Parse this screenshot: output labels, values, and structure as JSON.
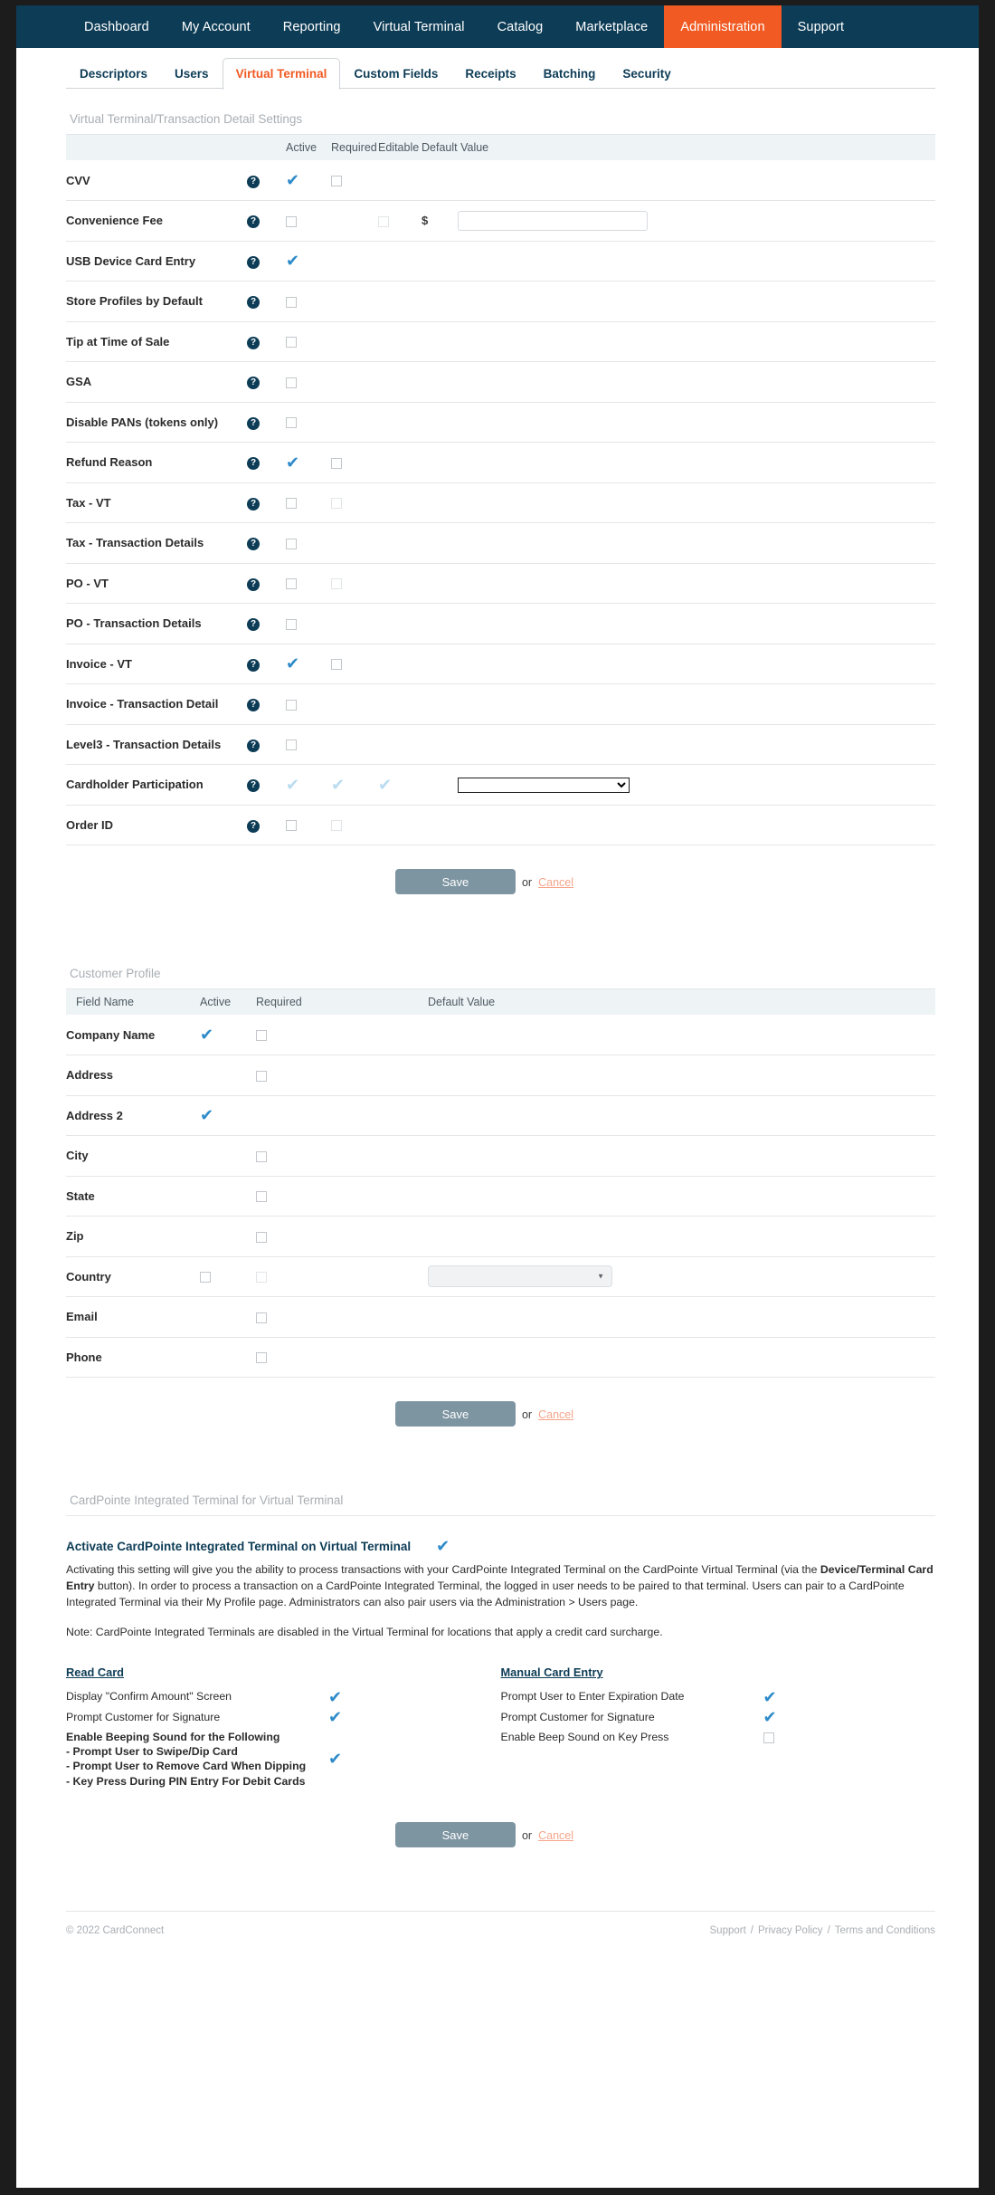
{
  "topnav": {
    "items": [
      {
        "label": "Dashboard",
        "active": false
      },
      {
        "label": "My Account",
        "active": false
      },
      {
        "label": "Reporting",
        "active": false
      },
      {
        "label": "Virtual Terminal",
        "active": false
      },
      {
        "label": "Catalog",
        "active": false
      },
      {
        "label": "Marketplace",
        "active": false
      },
      {
        "label": "Administration",
        "active": true
      },
      {
        "label": "Support",
        "active": false
      }
    ],
    "active_color": "#f15a22",
    "bar_color": "#0d3c56"
  },
  "subtabs": {
    "items": [
      {
        "label": "Descriptors",
        "active": false
      },
      {
        "label": "Users",
        "active": false
      },
      {
        "label": "Virtual Terminal",
        "active": true
      },
      {
        "label": "Custom Fields",
        "active": false
      },
      {
        "label": "Receipts",
        "active": false
      },
      {
        "label": "Batching",
        "active": false
      },
      {
        "label": "Security",
        "active": false
      }
    ]
  },
  "vt_section": {
    "title": "Virtual Terminal/Transaction Detail Settings",
    "columns": [
      "",
      "Active",
      "Required",
      "Editable",
      "Default Value"
    ],
    "rows": [
      {
        "label": "CVV",
        "help": true,
        "active": "checked",
        "required": "unchecked",
        "editable": "none",
        "default": "none"
      },
      {
        "label": "Convenience Fee",
        "help": true,
        "active": "unchecked",
        "required": "none",
        "editable": "unchecked-faded",
        "default": "money-input",
        "default_value": "",
        "currency": "$"
      },
      {
        "label": "USB Device Card Entry",
        "help": true,
        "active": "checked",
        "required": "none",
        "editable": "none",
        "default": "none"
      },
      {
        "label": "Store Profiles by Default",
        "help": true,
        "active": "unchecked",
        "required": "none",
        "editable": "none",
        "default": "none"
      },
      {
        "label": "Tip at Time of Sale",
        "help": true,
        "active": "unchecked",
        "required": "none",
        "editable": "none",
        "default": "none"
      },
      {
        "label": "GSA",
        "help": true,
        "active": "unchecked",
        "required": "none",
        "editable": "none",
        "default": "none"
      },
      {
        "label": "Disable PANs (tokens only)",
        "help": true,
        "active": "unchecked",
        "required": "none",
        "editable": "none",
        "default": "none"
      },
      {
        "label": "Refund Reason",
        "help": true,
        "active": "checked",
        "required": "unchecked",
        "editable": "none",
        "default": "none"
      },
      {
        "label": "Tax - VT",
        "help": true,
        "active": "unchecked",
        "required": "unchecked-faded",
        "editable": "none",
        "default": "none"
      },
      {
        "label": "Tax - Transaction Details",
        "help": true,
        "active": "unchecked",
        "required": "none",
        "editable": "none",
        "default": "none"
      },
      {
        "label": "PO - VT",
        "help": true,
        "active": "unchecked",
        "required": "unchecked-faded",
        "editable": "none",
        "default": "none"
      },
      {
        "label": "PO - Transaction Details",
        "help": true,
        "active": "unchecked",
        "required": "none",
        "editable": "none",
        "default": "none"
      },
      {
        "label": "Invoice - VT",
        "help": true,
        "active": "checked",
        "required": "unchecked",
        "editable": "none",
        "default": "none"
      },
      {
        "label": "Invoice - Transaction Detail",
        "help": true,
        "active": "unchecked",
        "required": "none",
        "editable": "none",
        "default": "none"
      },
      {
        "label": "Level3 - Transaction Details",
        "help": true,
        "active": "unchecked",
        "required": "none",
        "editable": "none",
        "default": "none"
      },
      {
        "label": "Cardholder Participation",
        "help": true,
        "active": "checked-faded",
        "required": "checked-faded",
        "editable": "checked-faded",
        "default": "select",
        "default_value": ""
      },
      {
        "label": "Order ID",
        "help": true,
        "active": "unchecked",
        "required": "unchecked-faded",
        "editable": "none",
        "default": "none"
      }
    ],
    "save_label": "Save",
    "or_label": "or",
    "cancel_label": "Cancel"
  },
  "customer_profile": {
    "title": "Customer Profile",
    "columns": [
      "Field Name",
      "Active",
      "Required",
      "Default Value"
    ],
    "rows": [
      {
        "label": "Company Name",
        "active": "checked",
        "required": "unchecked",
        "default": "none"
      },
      {
        "label": "Address",
        "active": "none",
        "required": "unchecked",
        "default": "none"
      },
      {
        "label": "Address 2",
        "active": "checked",
        "required": "none",
        "default": "none"
      },
      {
        "label": "City",
        "active": "none",
        "required": "unchecked",
        "default": "none"
      },
      {
        "label": "State",
        "active": "none",
        "required": "unchecked",
        "default": "none"
      },
      {
        "label": "Zip",
        "active": "none",
        "required": "unchecked",
        "default": "none"
      },
      {
        "label": "Country",
        "active": "unchecked",
        "required": "unchecked-faded",
        "default": "select-grey",
        "default_value": ""
      },
      {
        "label": "Email",
        "active": "none",
        "required": "unchecked",
        "default": "none"
      },
      {
        "label": "Phone",
        "active": "none",
        "required": "unchecked",
        "default": "none"
      }
    ],
    "save_label": "Save",
    "or_label": "or",
    "cancel_label": "Cancel"
  },
  "cardpointe": {
    "title": "CardPointe Integrated Terminal for Virtual Terminal",
    "activate_label": "Activate CardPointe Integrated Terminal on Virtual Terminal",
    "activate_state": "checked",
    "paragraph_1": "Activating this setting will give you the ability to process transactions with your CardPointe Integrated Terminal on the CardPointe Virtual Terminal (via the ",
    "paragraph_bold": "Device/Terminal Card Entry",
    "paragraph_2": " button). In order to process a transaction on a CardPointe Integrated Terminal, the logged in user needs to be paired to that terminal. Users can pair to a CardPointe Integrated Terminal via their My Profile page. Administrators can also pair users via the Administration > Users page.",
    "note": "Note: CardPointe Integrated Terminals are disabled in the Virtual Terminal for locations that apply a credit card surcharge.",
    "read_card": {
      "title": "Read Card",
      "rows": [
        {
          "label": "Display \"Confirm Amount\" Screen",
          "state": "checked",
          "bold": false
        },
        {
          "label": "Prompt Customer for Signature",
          "state": "checked",
          "bold": false
        },
        {
          "label": "Enable Beeping Sound for the Following\n- Prompt User to Swipe/Dip Card\n- Prompt User to Remove Card When Dipping\n- Key Press During PIN Entry For Debit Cards",
          "state": "checked",
          "bold": true
        }
      ]
    },
    "manual_card_entry": {
      "title": "Manual Card Entry",
      "rows": [
        {
          "label": "Prompt User to Enter Expiration Date",
          "state": "checked",
          "bold": false
        },
        {
          "label": "Prompt Customer for Signature",
          "state": "checked",
          "bold": false
        },
        {
          "label": "Enable Beep Sound on Key Press",
          "state": "unchecked",
          "bold": false
        }
      ]
    },
    "save_label": "Save",
    "or_label": "or",
    "cancel_label": "Cancel"
  },
  "footer": {
    "copyright": "© 2022 CardConnect",
    "links": [
      "Support",
      "Privacy Policy",
      "Terms and Conditions"
    ],
    "separator": "/"
  }
}
